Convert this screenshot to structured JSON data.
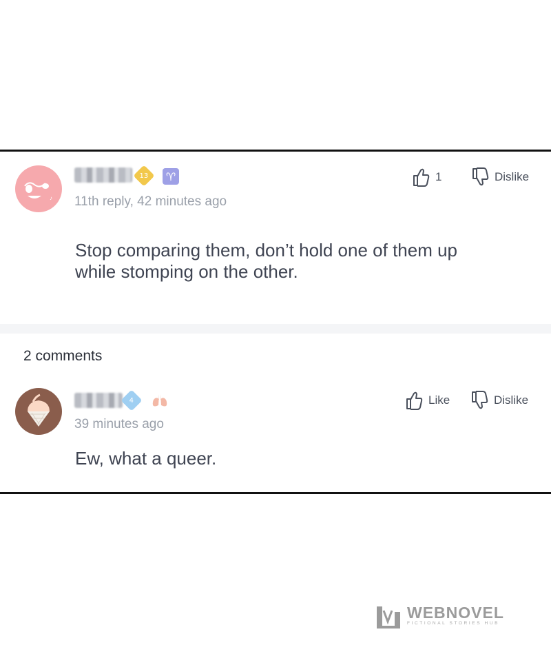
{
  "reply": {
    "level_badge": "13",
    "meta": "11th reply, 42 minutes ago",
    "text_line1": "Stop comparing them, don’t hold one of them up",
    "text_line2": "while stomping on the other.",
    "like_count": "1",
    "dislike_label": "Dislike",
    "zodiac_icon": "aries-icon",
    "badge_color": "#f2c84b",
    "zodiac_color": "#9ea0e6",
    "avatar_color": "#f6a9ad"
  },
  "comments_count_label": "2 comments",
  "comment": {
    "level_badge": "4",
    "meta": "39 minutes ago",
    "text": "Ew, what a queer.",
    "like_label": "Like",
    "dislike_label": "Dislike",
    "decor_icon": "lungs-icon",
    "badge_color": "#9fcff2",
    "avatar_color": "#8a5d4c"
  },
  "watermark": {
    "brand": "WEBNOVEL",
    "tagline": "FICTIONAL STORIES HUB"
  }
}
